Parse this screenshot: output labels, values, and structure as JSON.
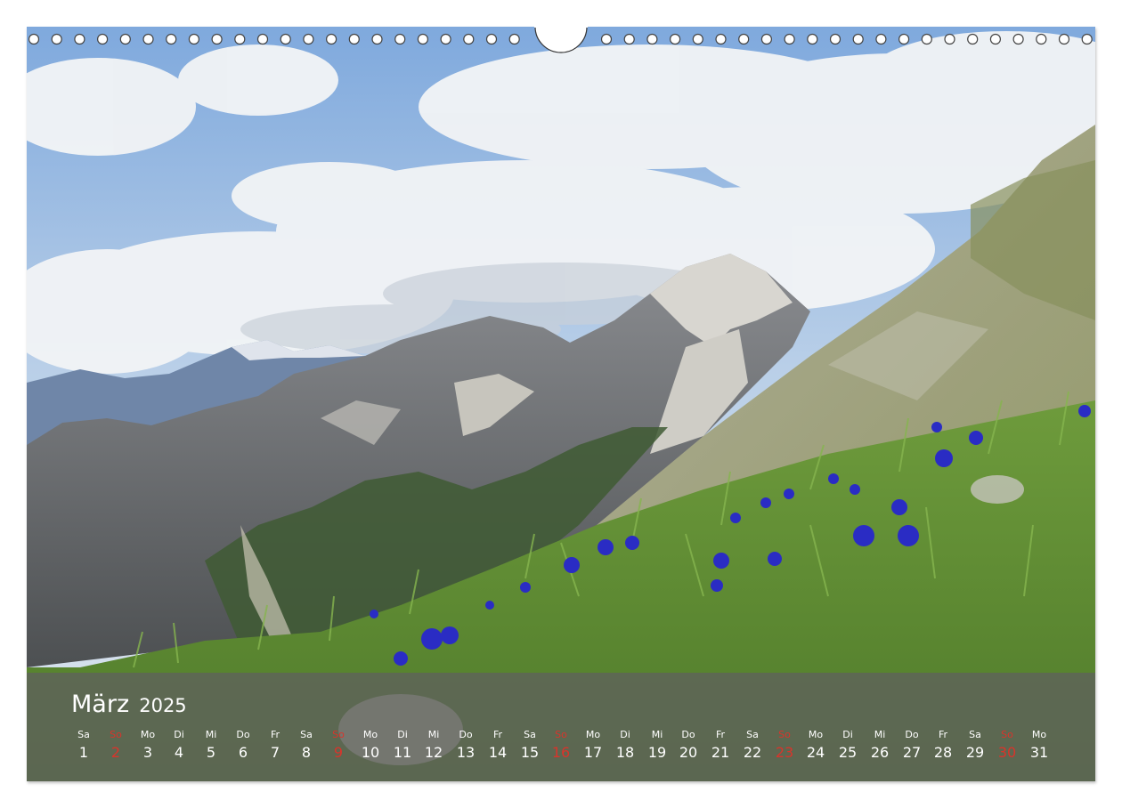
{
  "calendar": {
    "month": "März",
    "year": "2025",
    "days": [
      {
        "wd": "Sa",
        "d": "1"
      },
      {
        "wd": "So",
        "d": "2",
        "sun": true
      },
      {
        "wd": "Mo",
        "d": "3"
      },
      {
        "wd": "Di",
        "d": "4"
      },
      {
        "wd": "Mi",
        "d": "5"
      },
      {
        "wd": "Do",
        "d": "6"
      },
      {
        "wd": "Fr",
        "d": "7"
      },
      {
        "wd": "Sa",
        "d": "8"
      },
      {
        "wd": "So",
        "d": "9",
        "sun": true
      },
      {
        "wd": "Mo",
        "d": "10"
      },
      {
        "wd": "Di",
        "d": "11"
      },
      {
        "wd": "Mi",
        "d": "12"
      },
      {
        "wd": "Do",
        "d": "13"
      },
      {
        "wd": "Fr",
        "d": "14"
      },
      {
        "wd": "Sa",
        "d": "15"
      },
      {
        "wd": "So",
        "d": "16",
        "sun": true
      },
      {
        "wd": "Mo",
        "d": "17"
      },
      {
        "wd": "Di",
        "d": "18"
      },
      {
        "wd": "Mi",
        "d": "19"
      },
      {
        "wd": "Do",
        "d": "20"
      },
      {
        "wd": "Fr",
        "d": "21"
      },
      {
        "wd": "Sa",
        "d": "22"
      },
      {
        "wd": "So",
        "d": "23",
        "sun": true
      },
      {
        "wd": "Mo",
        "d": "24"
      },
      {
        "wd": "Di",
        "d": "25"
      },
      {
        "wd": "Mi",
        "d": "26"
      },
      {
        "wd": "Do",
        "d": "27"
      },
      {
        "wd": "Fr",
        "d": "28"
      },
      {
        "wd": "Sa",
        "d": "29"
      },
      {
        "wd": "So",
        "d": "30",
        "sun": true
      },
      {
        "wd": "Mo",
        "d": "31"
      }
    ]
  },
  "colors": {
    "sunday": "#d9342b",
    "band": "#5f625c",
    "gentian": "#2a2cc4"
  },
  "photo": {
    "subject": "alpine-meadow-with-gentians-icon"
  }
}
